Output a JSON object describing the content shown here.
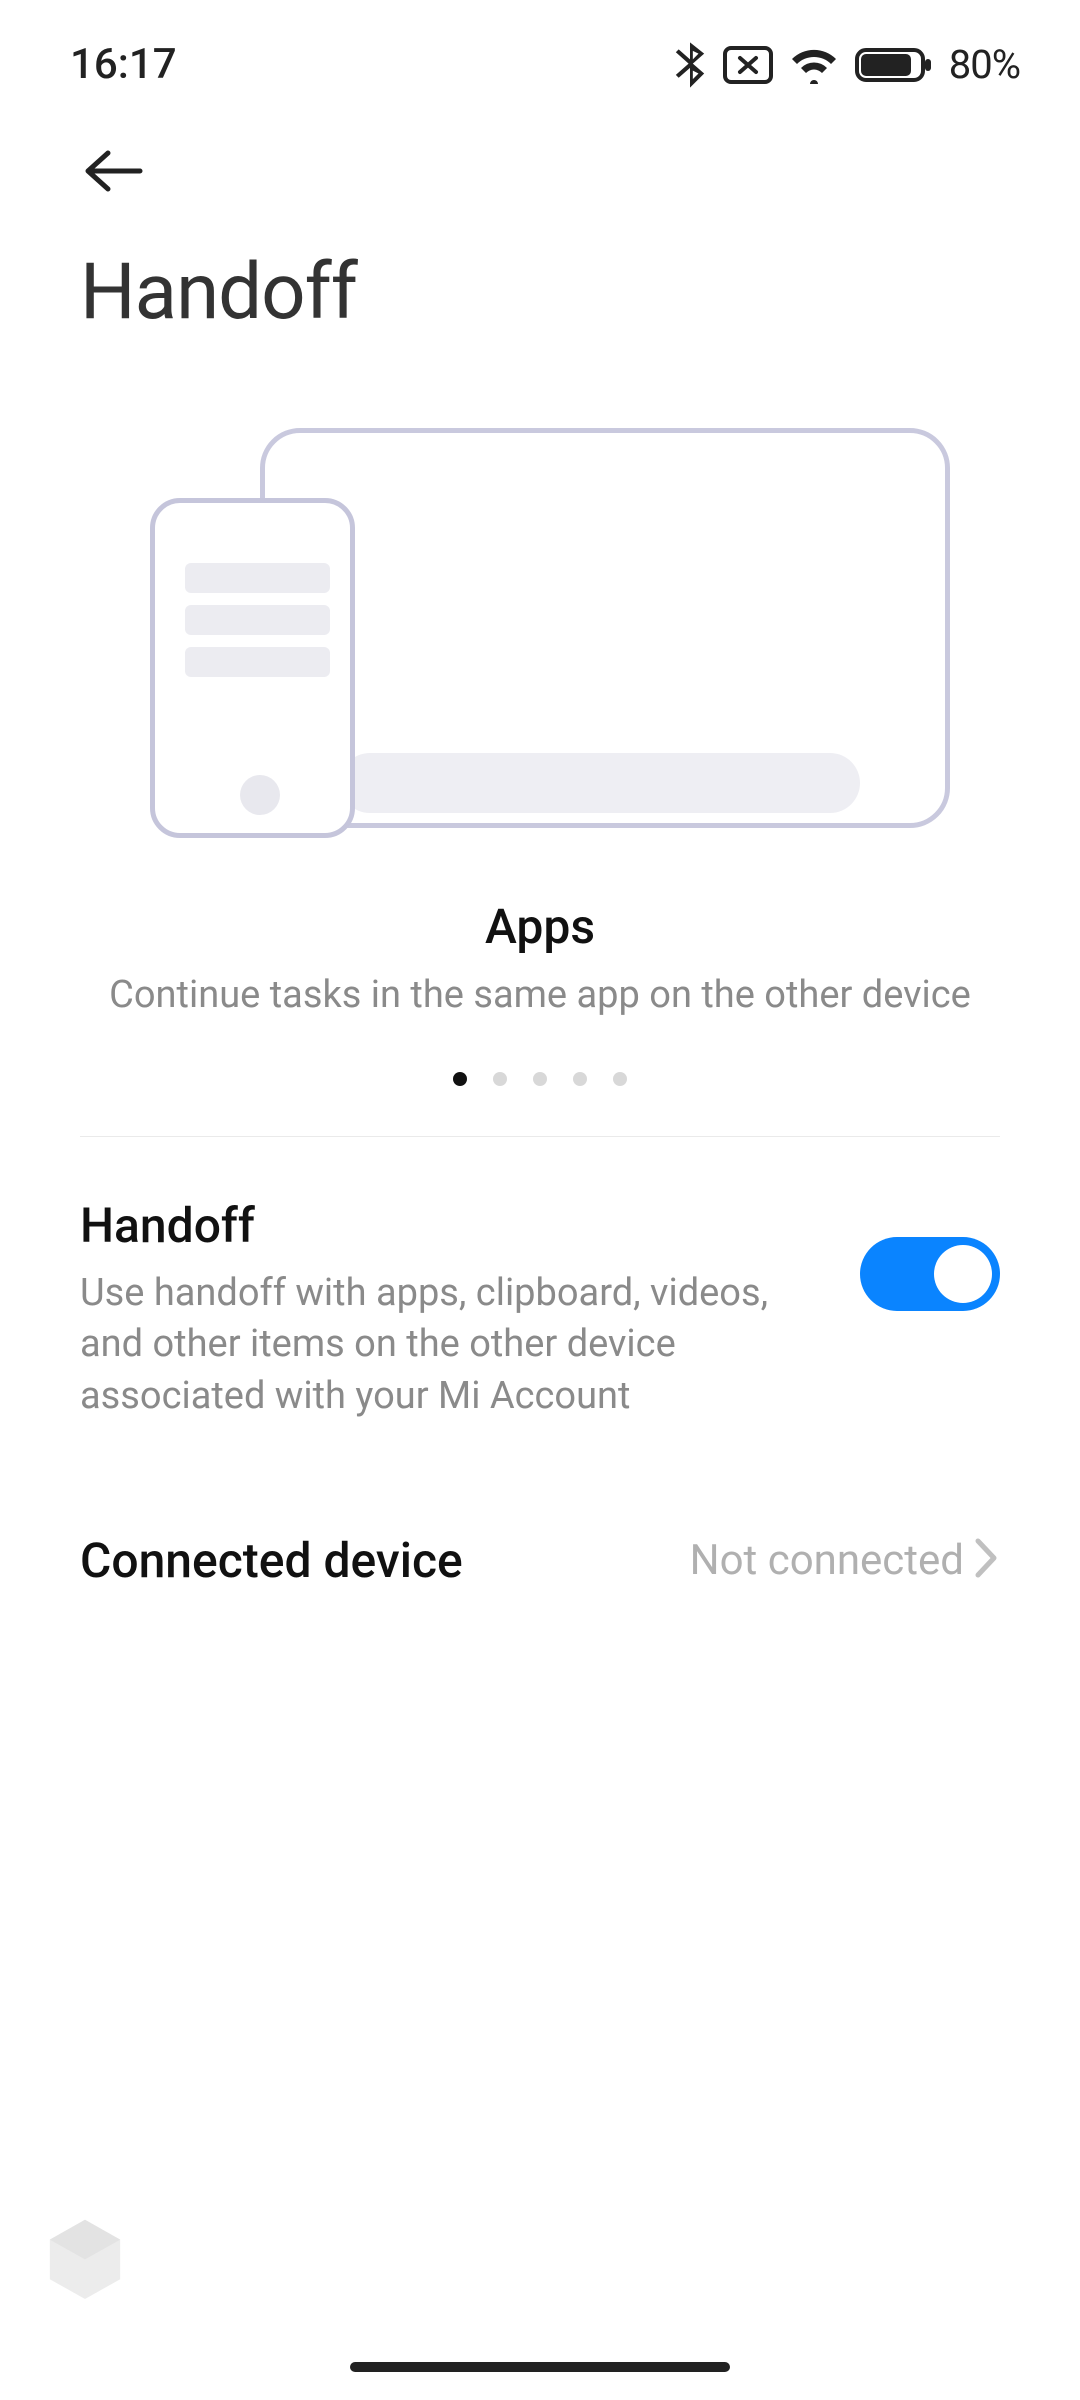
{
  "status": {
    "time": "16:17",
    "battery_text": "80%"
  },
  "page": {
    "title": "Handoff"
  },
  "carousel": {
    "title": "Apps",
    "subtitle": "Continue tasks in the same app on the other device",
    "active_index": 0,
    "count": 5
  },
  "settings": {
    "handoff": {
      "title": "Handoff",
      "desc": "Use handoff with apps, clipboard, videos, and other items on the other device associated with your Mi Account",
      "enabled": true
    },
    "connected_device": {
      "title": "Connected device",
      "value": "Not connected"
    }
  }
}
